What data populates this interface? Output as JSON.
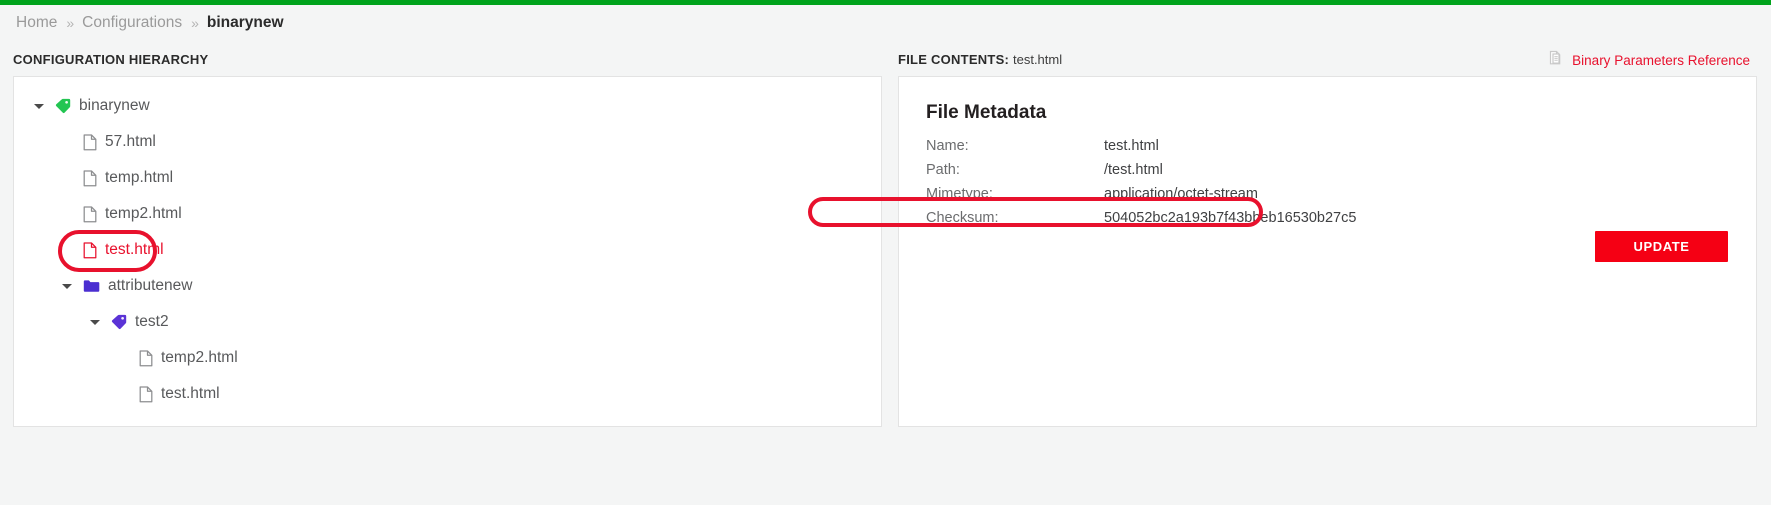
{
  "theme": {
    "accent_green": "#00a31c",
    "accent_red": "#e8112d",
    "button_red": "#f50014",
    "tag_green": "#23c552",
    "tag_purple": "#5b33d6",
    "folder_purple": "#4b2fd1"
  },
  "breadcrumb": {
    "items": [
      {
        "label": "Home",
        "current": false
      },
      {
        "label": "Configurations",
        "current": false
      },
      {
        "label": "binarynew",
        "current": true
      }
    ],
    "separator": "»"
  },
  "left_panel": {
    "heading": "CONFIGURATION HIERARCHY",
    "tree": [
      {
        "label": "binarynew",
        "icon": "tag-green-icon",
        "depth": 0,
        "expandable": true,
        "selected": false
      },
      {
        "label": "57.html",
        "icon": "file-icon",
        "depth": 1,
        "expandable": false,
        "selected": false
      },
      {
        "label": "temp.html",
        "icon": "file-icon",
        "depth": 1,
        "expandable": false,
        "selected": false
      },
      {
        "label": "temp2.html",
        "icon": "file-icon",
        "depth": 1,
        "expandable": false,
        "selected": false
      },
      {
        "label": "test.html",
        "icon": "file-icon",
        "depth": 1,
        "expandable": false,
        "selected": true
      },
      {
        "label": "attributenew",
        "icon": "folder-icon",
        "depth": 1,
        "expandable": true,
        "selected": false
      },
      {
        "label": "test2",
        "icon": "tag-purple-icon",
        "depth": 2,
        "expandable": true,
        "selected": false
      },
      {
        "label": "temp2.html",
        "icon": "file-icon",
        "depth": 3,
        "expandable": false,
        "selected": false
      },
      {
        "label": "test.html",
        "icon": "file-icon",
        "depth": 3,
        "expandable": false,
        "selected": false
      }
    ]
  },
  "right_panel": {
    "heading_label": "FILE CONTENTS:",
    "heading_value": "test.html",
    "reference_link": "Binary Parameters Reference",
    "metadata_title": "File Metadata",
    "metadata_rows": [
      {
        "key": "Name:",
        "value": "test.html"
      },
      {
        "key": "Path:",
        "value": "/test.html"
      },
      {
        "key": "Mimetype:",
        "value": "application/octet-stream"
      },
      {
        "key": "Checksum:",
        "value": "504052bc2a193b7f43bbeb16530b27c5"
      }
    ],
    "update_label": "UPDATE"
  }
}
